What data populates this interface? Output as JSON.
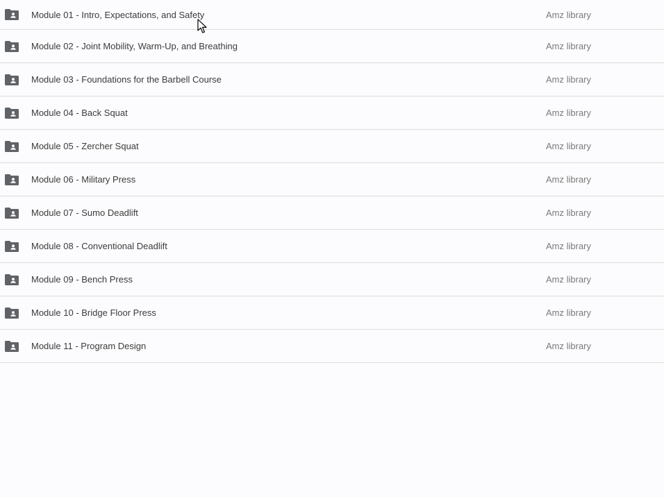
{
  "files": [
    {
      "name": "Module 01 - Intro, Expectations, and Safety",
      "owner": "Amz library",
      "icon": "shared-folder-icon"
    },
    {
      "name": "Module 02 - Joint Mobility, Warm-Up, and Breathing",
      "owner": "Amz library",
      "icon": "shared-folder-icon"
    },
    {
      "name": "Module 03 - Foundations for the Barbell Course",
      "owner": "Amz library",
      "icon": "shared-folder-icon"
    },
    {
      "name": "Module 04 - Back Squat",
      "owner": "Amz library",
      "icon": "shared-folder-icon"
    },
    {
      "name": "Module 05 - Zercher Squat",
      "owner": "Amz library",
      "icon": "shared-folder-icon"
    },
    {
      "name": "Module 06 - Military Press",
      "owner": "Amz library",
      "icon": "shared-folder-icon"
    },
    {
      "name": "Module 07 - Sumo Deadlift",
      "owner": "Amz library",
      "icon": "shared-folder-icon"
    },
    {
      "name": "Module 08 - Conventional Deadlift",
      "owner": "Amz library",
      "icon": "shared-folder-icon"
    },
    {
      "name": "Module 09 - Bench Press",
      "owner": "Amz library",
      "icon": "shared-folder-icon"
    },
    {
      "name": "Module 10 - Bridge Floor Press",
      "owner": "Amz library",
      "icon": "shared-folder-icon"
    },
    {
      "name": "Module 11 - Program Design",
      "owner": "Amz library",
      "icon": "shared-folder-icon"
    }
  ],
  "colors": {
    "background": "#fcfbfd",
    "icon": "#5f6368",
    "name_text": "#3c3c3c",
    "owner_text": "#7a7a7a",
    "divider": "#dddddd"
  }
}
